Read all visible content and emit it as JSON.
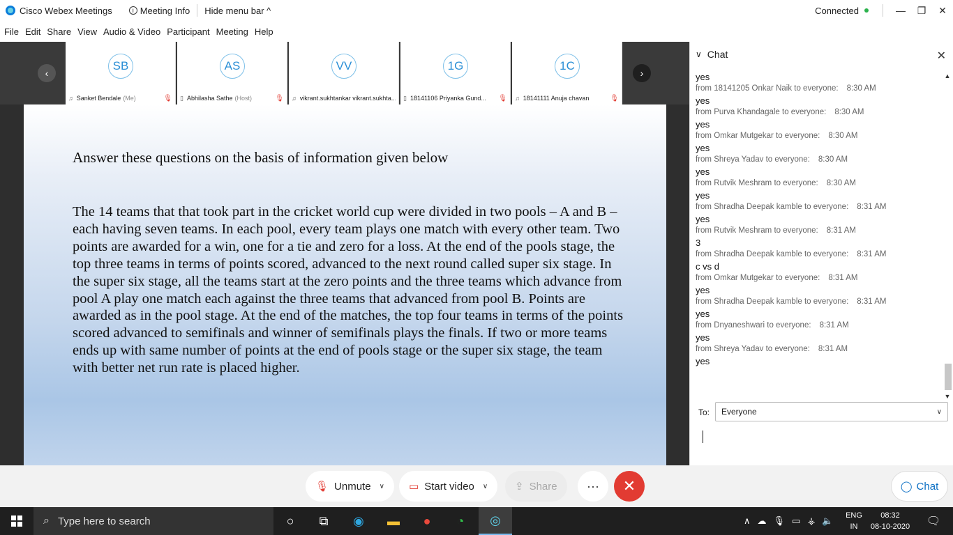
{
  "titlebar": {
    "app_name": "Cisco Webex Meetings",
    "meeting_info": "Meeting Info",
    "hide_menu": "Hide menu bar ^",
    "status": "Connected",
    "status_color": "#2bb24c"
  },
  "menu": [
    "File",
    "Edit",
    "Share",
    "View",
    "Audio & Video",
    "Participant",
    "Meeting",
    "Help"
  ],
  "participants": [
    {
      "initials": "SB",
      "name": "Sanket Bendale",
      "role": "(Me)"
    },
    {
      "initials": "AS",
      "name": "Abhilasha Sathe",
      "role": "(Host)"
    },
    {
      "initials": "VV",
      "name": "vikrant.sukhtankar vikrant.sukhta...",
      "role": ""
    },
    {
      "initials": "1G",
      "name": "18141106 Priyanka Gund...",
      "role": ""
    },
    {
      "initials": "1C",
      "name": "18141111 Anuja chavan",
      "role": ""
    }
  ],
  "slide": {
    "heading": "Answer these questions on the basis of information given below",
    "body": "The 14 teams that that took part in the cricket world cup were divided in two pools – A and B – each having seven teams. In each pool, every team plays one match with every other team. Two points are awarded for a win, one for a tie and zero for a loss. At the end of the pools stage, the top three teams in terms of points scored, advanced to the next round called super six stage. In the super six stage, all the teams start at the zero points and the three teams which advance from pool A play one match each against the three teams that advanced from pool B. Points are awarded as in the pool stage. At the end of the matches, the top four teams in terms of the points scored advanced to semifinals and winner of semifinals plays the finals. If two or more teams ends up with same number of points at the end of pools stage or the super six stage, the team with better net run rate is placed higher."
  },
  "chat": {
    "title": "Chat",
    "messages": [
      {
        "text": "yes"
      },
      {
        "from": "from 18141205 Onkar Naik to everyone:",
        "time": "8:30 AM",
        "text": "yes"
      },
      {
        "from": "from Purva Khandagale to everyone:",
        "time": "8:30 AM",
        "text": "yes"
      },
      {
        "from": "from Omkar Mutgekar to everyone:",
        "time": "8:30 AM",
        "text": "yes"
      },
      {
        "from": "from Shreya Yadav to everyone:",
        "time": "8:30 AM",
        "text": "yes"
      },
      {
        "from": "from Rutvik Meshram to everyone:",
        "time": "8:30 AM",
        "text": "yes"
      },
      {
        "from": "from Shradha Deepak kamble to everyone:",
        "time": "8:31 AM",
        "text": "yes"
      },
      {
        "from": "from Rutvik Meshram to everyone:",
        "time": "8:31 AM",
        "text": "3"
      },
      {
        "from": "from Shradha Deepak kamble to everyone:",
        "time": "8:31 AM",
        "text": "c vs d"
      },
      {
        "from": "from Omkar Mutgekar to everyone:",
        "time": "8:31 AM",
        "text": "yes"
      },
      {
        "from": "from Shradha Deepak kamble to everyone:",
        "time": "8:31 AM",
        "text": "yes"
      },
      {
        "from": "from Dnyaneshwari to everyone:",
        "time": "8:31 AM",
        "text": "yes"
      },
      {
        "from": "from Shreya Yadav to everyone:",
        "time": "8:31 AM",
        "text": "yes"
      }
    ],
    "to_label": "To:",
    "to_value": "Everyone"
  },
  "controls": {
    "unmute": "Unmute",
    "start_video": "Start video",
    "share": "Share",
    "chat": "Chat",
    "leave_color": "#e23b32"
  },
  "taskbar": {
    "search_placeholder": "Type here to search",
    "lang_top": "ENG",
    "lang_bottom": "IN",
    "time": "08:32",
    "date": "08-10-2020"
  }
}
